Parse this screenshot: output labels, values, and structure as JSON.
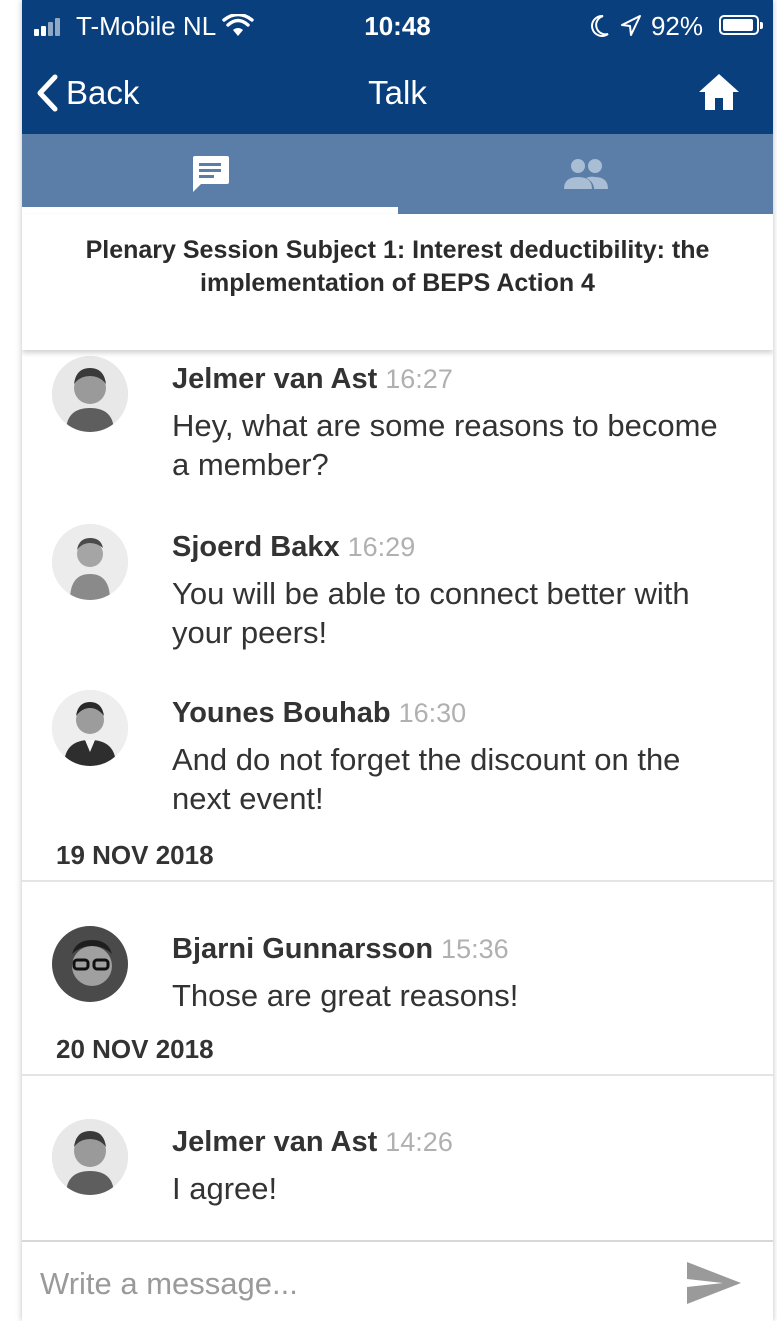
{
  "status_bar": {
    "carrier": "T-Mobile NL",
    "time": "10:48",
    "battery": "92%"
  },
  "nav": {
    "back_label": "Back",
    "title": "Talk"
  },
  "tabs": [
    {
      "icon": "chat-icon",
      "active": true
    },
    {
      "icon": "people-icon",
      "active": false
    }
  ],
  "session": {
    "title": "Plenary Session Subject 1: Interest deductibility: the implementation of BEPS Action 4"
  },
  "messages": [
    {
      "author": "Jelmer van Ast",
      "time": "16:27",
      "text": "Hey, what are some reasons to become a member?"
    },
    {
      "author": "Sjoerd Bakx",
      "time": "16:29",
      "text": "You will be able to connect better with your peers!"
    },
    {
      "author": "Younes Bouhab",
      "time": "16:30",
      "text": "And do not forget the discount on the next event!"
    },
    {
      "author": "Bjarni Gunnarsson",
      "time": "15:36",
      "text": "Those are great reasons!"
    },
    {
      "author": "Jelmer van Ast",
      "time": "14:26",
      "text": "I agree!"
    }
  ],
  "date_separators": [
    "19 NOV 2018",
    "20 NOV 2018"
  ],
  "composer": {
    "placeholder": "Write a message..."
  },
  "colors": {
    "nav_bg": "#0a3f7d",
    "tab_bg": "#5a7ea8",
    "inactive_icon": "#a9bdd4"
  }
}
